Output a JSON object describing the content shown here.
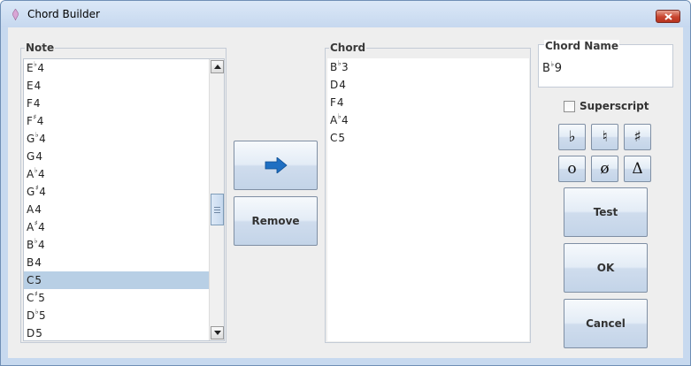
{
  "window": {
    "title": "Chord Builder"
  },
  "note_panel": {
    "title": "Note",
    "items": [
      {
        "letter": "E",
        "acc": "♭",
        "oct": "4"
      },
      {
        "letter": "E",
        "acc": "",
        "oct": "4"
      },
      {
        "letter": "F",
        "acc": "",
        "oct": "4"
      },
      {
        "letter": "F",
        "acc": "♯",
        "oct": "4"
      },
      {
        "letter": "G",
        "acc": "♭",
        "oct": "4"
      },
      {
        "letter": "G",
        "acc": "",
        "oct": "4"
      },
      {
        "letter": "A",
        "acc": "♭",
        "oct": "4"
      },
      {
        "letter": "G",
        "acc": "♯",
        "oct": "4"
      },
      {
        "letter": "A",
        "acc": "",
        "oct": "4"
      },
      {
        "letter": "A",
        "acc": "♯",
        "oct": "4"
      },
      {
        "letter": "B",
        "acc": "♭",
        "oct": "4"
      },
      {
        "letter": "B",
        "acc": "",
        "oct": "4"
      },
      {
        "letter": "C",
        "acc": "",
        "oct": "5",
        "selected": true
      },
      {
        "letter": "C",
        "acc": "♯",
        "oct": "5"
      },
      {
        "letter": "D",
        "acc": "♭",
        "oct": "5"
      },
      {
        "letter": "D",
        "acc": "",
        "oct": "5"
      }
    ]
  },
  "middle_buttons": {
    "add_icon": "arrow-right-icon",
    "remove_label": "Remove"
  },
  "chord_panel": {
    "title": "Chord",
    "items": [
      {
        "letter": "B",
        "acc": "♭",
        "oct": "3"
      },
      {
        "letter": "D",
        "acc": "",
        "oct": "4"
      },
      {
        "letter": "F",
        "acc": "",
        "oct": "4"
      },
      {
        "letter": "A",
        "acc": "♭",
        "oct": "4"
      },
      {
        "letter": "C",
        "acc": "",
        "oct": "5"
      }
    ]
  },
  "chord_name": {
    "title": "Chord Name",
    "letter": "B",
    "acc": "♭",
    "rest": "9"
  },
  "superscript": {
    "label": "Superscript",
    "checked": false
  },
  "symbols": [
    {
      "glyph": "♭",
      "name": "flat-symbol-button"
    },
    {
      "glyph": "♮",
      "name": "natural-symbol-button"
    },
    {
      "glyph": "♯",
      "name": "sharp-symbol-button"
    },
    {
      "glyph": "o",
      "name": "diminished-symbol-button"
    },
    {
      "glyph": "ø",
      "name": "half-diminished-symbol-button"
    },
    {
      "glyph": "Δ",
      "name": "major-seventh-symbol-button"
    }
  ],
  "actions": {
    "test_label": "Test",
    "ok_label": "OK",
    "cancel_label": "Cancel"
  },
  "colors": {
    "selection": "#b8cfe5",
    "arrow": "#1f6fc2",
    "close": "#c8452f"
  }
}
